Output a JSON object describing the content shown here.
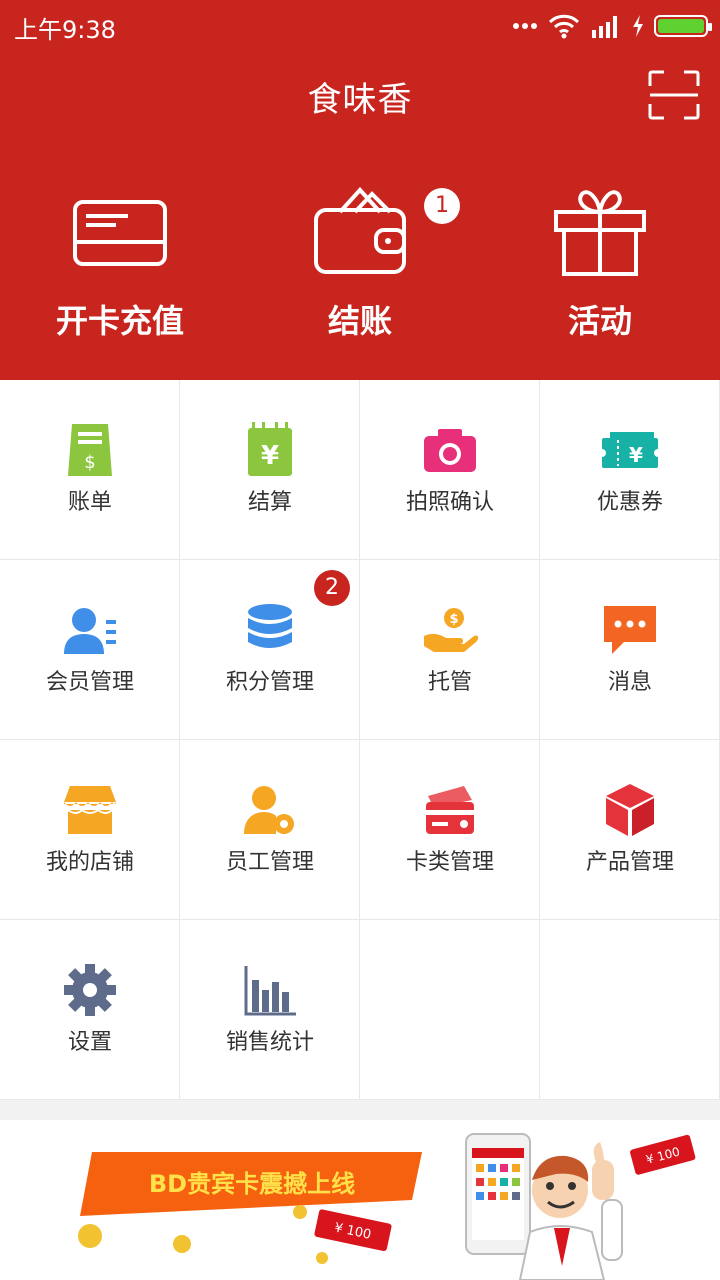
{
  "status_bar": {
    "time": "上午9:38"
  },
  "header": {
    "title": "食味香"
  },
  "actions": [
    {
      "label": "开卡充值",
      "icon": "card-icon"
    },
    {
      "label": "结账",
      "icon": "wallet-icon",
      "badge": "1"
    },
    {
      "label": "活动",
      "icon": "gift-icon"
    }
  ],
  "grid": [
    {
      "label": "账单",
      "icon": "bill-icon",
      "color": "#8cc63f"
    },
    {
      "label": "结算",
      "icon": "settlement-icon",
      "color": "#8cc63f"
    },
    {
      "label": "拍照确认",
      "icon": "camera-icon",
      "color": "#e8307a"
    },
    {
      "label": "优惠券",
      "icon": "coupon-icon",
      "color": "#18b1a5"
    },
    {
      "label": "会员管理",
      "icon": "member-icon",
      "color": "#3f8fe8"
    },
    {
      "label": "积分管理",
      "icon": "points-icon",
      "color": "#3f8fe8",
      "badge": "2"
    },
    {
      "label": "托管",
      "icon": "hosting-icon",
      "color": "#f5a623"
    },
    {
      "label": "消息",
      "icon": "message-icon",
      "color": "#f26522"
    },
    {
      "label": "我的店铺",
      "icon": "store-icon",
      "color": "#f5a623"
    },
    {
      "label": "员工管理",
      "icon": "staff-icon",
      "color": "#f5a623"
    },
    {
      "label": "卡类管理",
      "icon": "card-manage-icon",
      "color": "#e5333b"
    },
    {
      "label": "产品管理",
      "icon": "product-icon",
      "color": "#e5333b"
    },
    {
      "label": "设置",
      "icon": "gear-icon",
      "color": "#5f6b8a"
    },
    {
      "label": "销售统计",
      "icon": "chart-icon",
      "color": "#5f6b8a"
    }
  ],
  "banner": {
    "headline": "BD贵宾卡震撼上线",
    "price_tag": "¥ 100"
  },
  "colors": {
    "brand_red": "#c8251f"
  }
}
